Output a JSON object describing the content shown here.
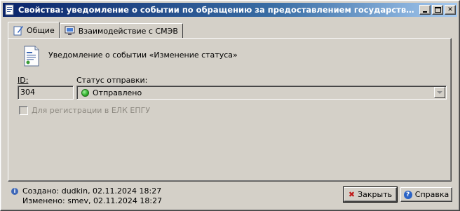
{
  "window": {
    "title": "Свойства: уведомление о событии по обращению за предоставлением государственной услуги..."
  },
  "tabs": [
    {
      "label": "Общие",
      "icon": "edit-document-icon"
    },
    {
      "label": "Взаимодействие с СМЭВ",
      "icon": "monitor-icon"
    }
  ],
  "general": {
    "header": "Уведомление о событии «Изменение статуса»",
    "id_label": "ID:",
    "id_value": "304",
    "status_label": "Статус отправки:",
    "status_value": "Отправлено",
    "status_color": "#34b52f",
    "checkbox_label": "Для регистрации в ЕЛК ЕПГУ",
    "checkbox_checked": false
  },
  "footer": {
    "created": "Создано: dudkin, 02.11.2024 18:27",
    "modified": "Изменено: smev, 02.11.2024 18:27",
    "close_label": "Закрыть",
    "help_label": "Справка"
  }
}
